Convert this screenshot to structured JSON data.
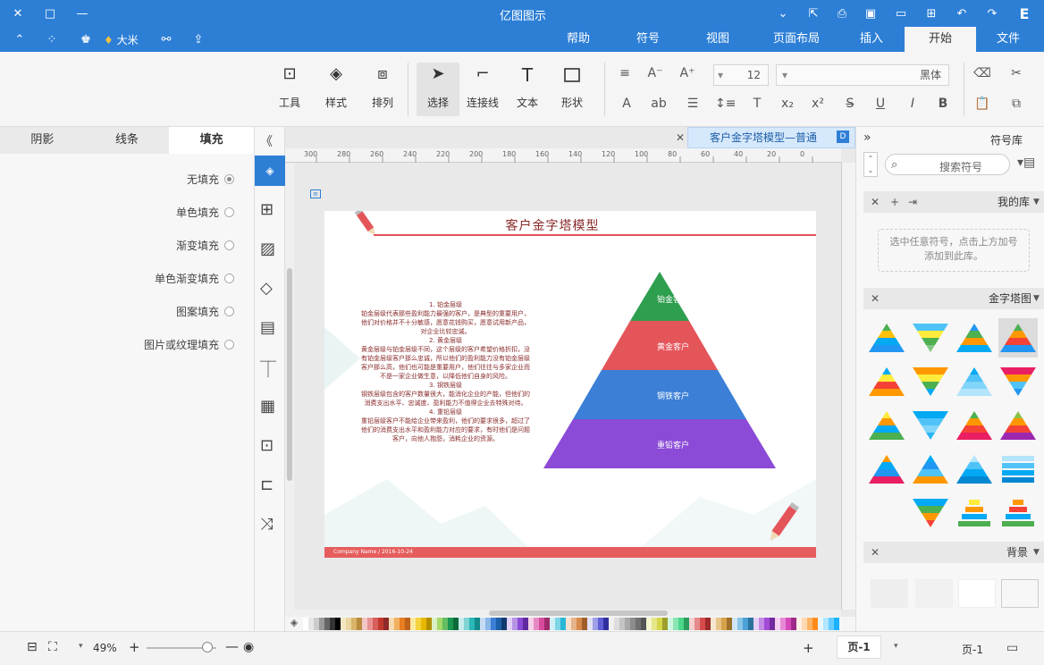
{
  "window": {
    "title": "亿图图示"
  },
  "menu": {
    "tabs": [
      "文件",
      "开始",
      "插入",
      "页面布局",
      "视图",
      "符号",
      "帮助"
    ],
    "active": "开始",
    "user": "大米"
  },
  "ribbon": {
    "font_name": "黑体",
    "font_size": "12",
    "buttons": {
      "shape": "形状",
      "text": "文本",
      "connector": "连接线",
      "select": "选择",
      "arrange": "排列",
      "style": "样式",
      "tools": "工具"
    }
  },
  "left_panel": {
    "tabs": [
      "填充",
      "线条",
      "阴影"
    ],
    "active_tab": "填充",
    "fill_options": [
      "无填充",
      "单色填充",
      "渐变填充",
      "单色渐变填充",
      "图案填充",
      "图片或纹理填充"
    ],
    "selected_fill": "无填充"
  },
  "document": {
    "tab_title": "客户金字塔模型—普通",
    "page_title": "客户金字塔模型",
    "body_text": "1. 铂金层级\n铂金层级代表那些盈利能力最强的客户，是典型的重要用户，他们对价格并不十分敏感，愿意花钱购买，愿意试用新产品，对企业比较忠诚。\n2. 黄金层级\n黄金层级与铂金层级不同，这个层级的客户希望价格折扣，没有铂金层级客户那么忠诚，所以他们的盈利能力没有铂金层级客户那么高，他们也可能是重要用户，他们往往与多家企业而不是一家企业做生意，以降低他们自身的风险。\n3. 钢铁层级\n钢铁层级包含的客户数量很大，能消化企业的产能，但他们的消费支出水平、忠诚度、盈利能力不值得企业去特殊对待。\n4. 重铅层级\n重铅层级客户不能给企业带来盈利，他们的要求很多，超过了他们的消费支出水平和盈利能力对应的要求，有时他们是问题客户，向他人抱怨，消耗企业的资源。",
    "footer_text": "Company Name / 2016-10-24",
    "pyramid_levels": [
      "铂金客户",
      "黄金客户",
      "钢铁客户",
      "重铅客户"
    ],
    "pyramid_colors": [
      "#2e9e4f",
      "#e4555a",
      "#3b7fd6",
      "#8b4bd6"
    ],
    "ruler_ticks": [
      "0",
      "20",
      "40",
      "60",
      "80",
      "100",
      "120",
      "140",
      "160",
      "180",
      "200",
      "220",
      "240",
      "260",
      "280",
      "300"
    ]
  },
  "right_panel": {
    "title": "符号库",
    "search_placeholder": "搜索符号",
    "my_library": "我的库",
    "library_hint": "选中任意符号，点击上方加号添加到此库。",
    "pyramid_section": "金字塔图",
    "background_section": "背景"
  },
  "status": {
    "page_label": "页-1",
    "page_tab": "页-1",
    "zoom": "49%"
  },
  "accent": "#2d7fd6"
}
